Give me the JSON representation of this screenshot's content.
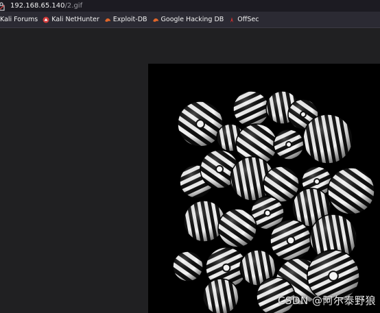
{
  "browser": {
    "url_host": "192.168.65.140",
    "url_path": "/2.gif"
  },
  "bookmarks": [
    {
      "label": "Kali Forums",
      "icon": "kali-dragon-icon"
    },
    {
      "label": "Kali NetHunter",
      "icon": "nethunter-icon"
    },
    {
      "label": "Exploit-DB",
      "icon": "exploit-db-icon"
    },
    {
      "label": "Google Hacking DB",
      "icon": "ghdb-icon"
    },
    {
      "label": "OffSec",
      "icon": "offsec-icon"
    }
  ],
  "image": {
    "description_icon": "striped-spheres-gif",
    "background_color": "#000000"
  },
  "watermark": {
    "text": "CSDN @阿尔泰野狼"
  },
  "colors": {
    "urlbar_bg": "#1c1b22",
    "toolbar_bg": "#2b2a33",
    "page_bg": "#202022"
  }
}
